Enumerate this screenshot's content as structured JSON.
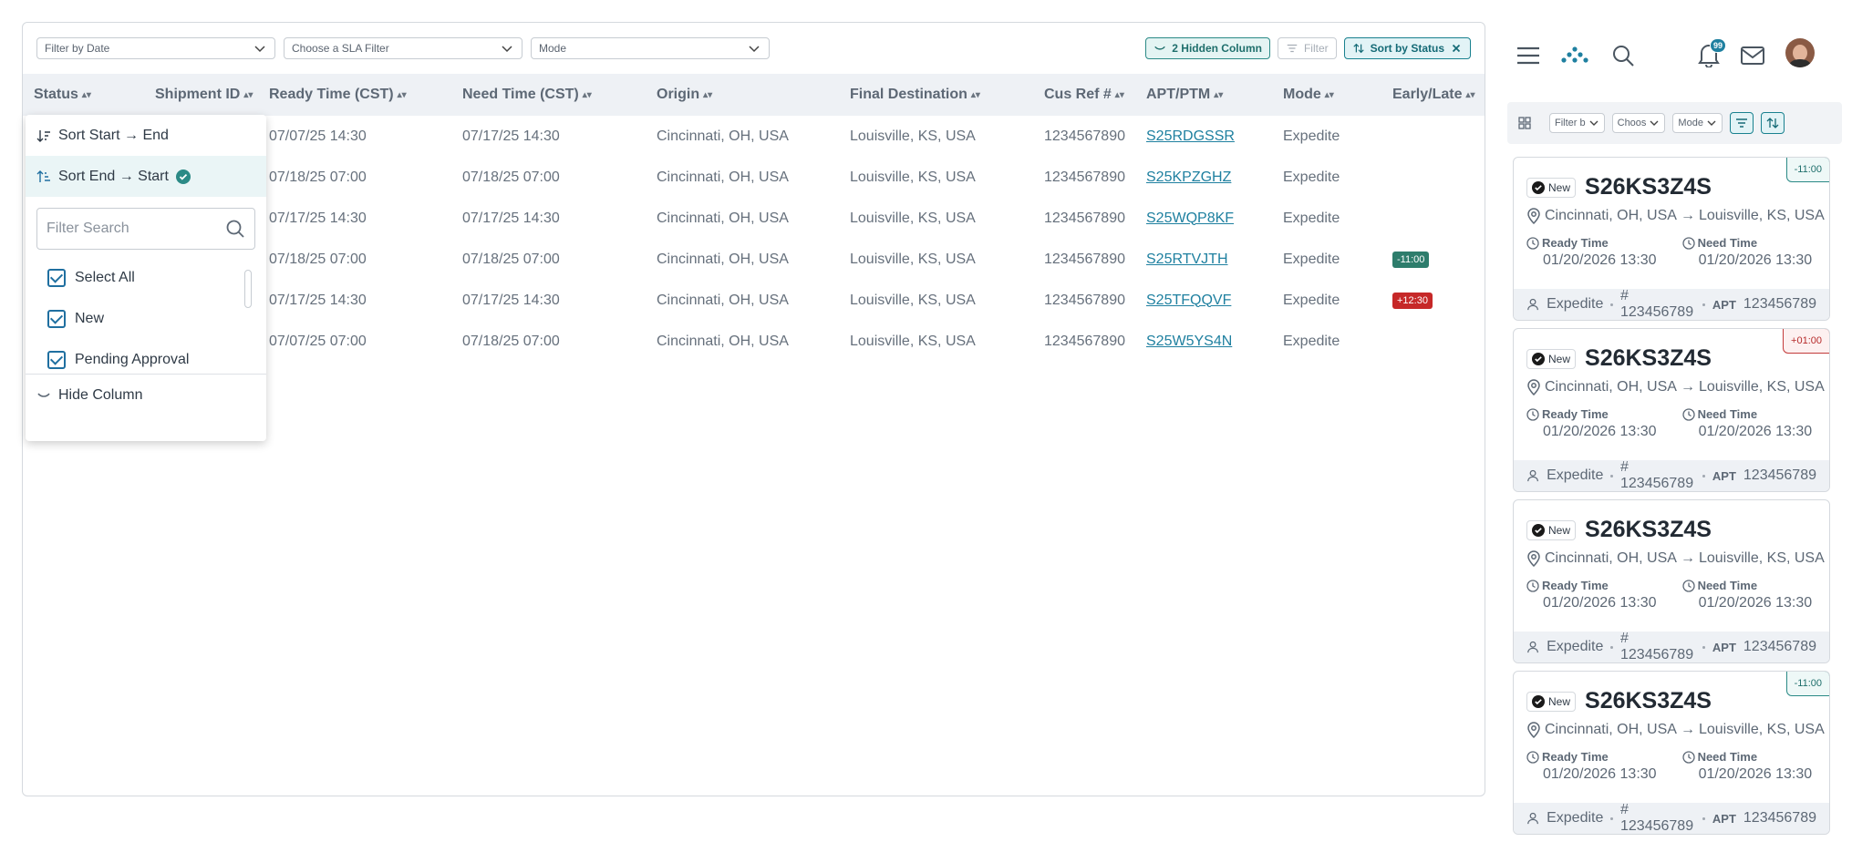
{
  "filters": {
    "date": "Filter by Date",
    "sla": "Choose a SLA Filter",
    "mode": "Mode",
    "hidden_columns": "2 Hidden Column",
    "filter": "Filter",
    "sort": "Sort by Status"
  },
  "columns": [
    "Status",
    "Shipment ID",
    "Ready Time (CST)",
    "Need Time (CST)",
    "Origin",
    "Final Destination",
    "Cus Ref #",
    "APT/PTM",
    "Mode",
    "Early/Late"
  ],
  "rows": [
    {
      "ready": "07/07/25 14:30",
      "need": "07/17/25 14:30",
      "origin": "Cincinnati, OH, USA",
      "dest": "Louisville, KS, USA",
      "cusref": "1234567890",
      "apt": "S25RDGSSR",
      "mode": "Expedite",
      "el": ""
    },
    {
      "ready": "07/18/25  07:00",
      "need": "07/18/25  07:00",
      "origin": "Cincinnati, OH, USA",
      "dest": "Louisville, KS, USA",
      "cusref": "1234567890",
      "apt": "S25KPZGHZ",
      "mode": "Expedite",
      "el": ""
    },
    {
      "ready": "07/17/25 14:30",
      "need": "07/17/25 14:30",
      "origin": "Cincinnati, OH, USA",
      "dest": "Louisville, KS, USA",
      "cusref": "1234567890",
      "apt": "S25WQP8KF",
      "mode": "Expedite",
      "el": ""
    },
    {
      "ready": "07/18/25  07:00",
      "need": "07/18/25  07:00",
      "origin": "Cincinnati, OH, USA",
      "dest": "Louisville, KS, USA",
      "cusref": "1234567890",
      "apt": "S25RTVJTH",
      "mode": "Expedite",
      "el": "-11:00"
    },
    {
      "ready": "07/17/25 14:30",
      "need": "07/17/25 14:30",
      "origin": "Cincinnati, OH, USA",
      "dest": "Louisville, KS, USA",
      "cusref": "1234567890",
      "apt": "S25TFQQVF",
      "mode": "Expedite",
      "el": "+12:30"
    },
    {
      "ready": "07/07/25  07:00",
      "need": "07/18/25  07:00",
      "origin": "Cincinnati, OH, USA",
      "dest": "Louisville, KS, USA",
      "cusref": "1234567890",
      "apt": "S25W5YS4N",
      "mode": "Expedite",
      "el": ""
    }
  ],
  "popup": {
    "sort_asc": "Sort Start → End",
    "sort_desc": "Sort End → Start",
    "search_placeholder": "Filter Search",
    "options": [
      {
        "label": "Select All",
        "checked": true
      },
      {
        "label": "New",
        "checked": true
      },
      {
        "label": "Pending Approval",
        "checked": true
      }
    ],
    "hide_column": "Hide Column"
  },
  "mobile": {
    "notifications_count": "99",
    "filter_date": "Filter b",
    "filter_sla": "Choos",
    "filter_mode": "Mode",
    "cards": [
      {
        "status": "New",
        "id": "S26KS3Z4S",
        "origin": "Cincinnati, OH, USA",
        "dest": "Louisville, KS, USA",
        "ready_label": "Ready Time",
        "ready": "01/20/2026 13:30",
        "need_label": "Need Time",
        "need": "01/20/2026 13:30",
        "mode": "Expedite",
        "ref": "# 123456789",
        "apt_label": "APT",
        "apt": "123456789",
        "el": "-11:00",
        "el_color": "green"
      },
      {
        "status": "New",
        "id": "S26KS3Z4S",
        "origin": "Cincinnati, OH, USA",
        "dest": "Louisville, KS, USA",
        "ready_label": "Ready Time",
        "ready": "01/20/2026 13:30",
        "need_label": "Need Time",
        "need": "01/20/2026 13:30",
        "mode": "Expedite",
        "ref": "# 123456789",
        "apt_label": "APT",
        "apt": "123456789",
        "el": "+01:00",
        "el_color": "red"
      },
      {
        "status": "New",
        "id": "S26KS3Z4S",
        "origin": "Cincinnati, OH, USA",
        "dest": "Louisville, KS, USA",
        "ready_label": "Ready Time",
        "ready": "01/20/2026 13:30",
        "need_label": "Need Time",
        "need": "01/20/2026 13:30",
        "mode": "Expedite",
        "ref": "# 123456789",
        "apt_label": "APT",
        "apt": "123456789",
        "el": "",
        "el_color": ""
      },
      {
        "status": "New",
        "id": "S26KS3Z4S",
        "origin": "Cincinnati, OH, USA",
        "dest": "Louisville, KS, USA",
        "ready_label": "Ready Time",
        "ready": "01/20/2026 13:30",
        "need_label": "Need Time",
        "need": "01/20/2026 13:30",
        "mode": "Expedite",
        "ref": "# 123456789",
        "apt_label": "APT",
        "apt": "123456789",
        "el": "-11:00",
        "el_color": "green"
      }
    ]
  },
  "colors": {
    "accent": "#2b8a86",
    "link": "#1f80a0",
    "late": "#c62828",
    "early": "#2e7d6c"
  }
}
